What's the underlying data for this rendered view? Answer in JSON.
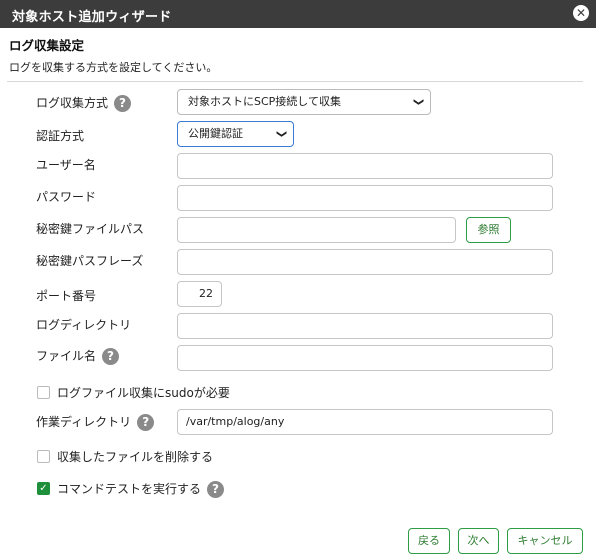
{
  "window": {
    "title": "対象ホスト追加ウィザード",
    "close_icon": "✕"
  },
  "section": {
    "title": "ログ収集設定",
    "description": "ログを収集する方式を設定してください。"
  },
  "form": {
    "collect_method": {
      "label": "ログ収集方式",
      "value": "対象ホストにSCP接続して収集"
    },
    "auth_method": {
      "label": "認証方式",
      "value": "公開鍵認証"
    },
    "username": {
      "label": "ユーザー名",
      "value": ""
    },
    "password": {
      "label": "パスワード",
      "value": ""
    },
    "key_file": {
      "label": "秘密鍵ファイルパス",
      "value": "",
      "browse_label": "参照"
    },
    "passphrase": {
      "label": "秘密鍵パスフレーズ",
      "value": ""
    },
    "port": {
      "label": "ポート番号",
      "value": "22"
    },
    "log_dir": {
      "label": "ログディレクトリ",
      "value": ""
    },
    "file_name": {
      "label": "ファイル名",
      "value": ""
    },
    "sudo": {
      "label": "ログファイル収集にsudoが必要",
      "checked": false
    },
    "work_dir": {
      "label": "作業ディレクトリ",
      "value": "/var/tmp/alog/any"
    },
    "delete_after": {
      "label": "収集したファイルを削除する",
      "checked": false
    },
    "command_test": {
      "label": "コマンドテストを実行する",
      "checked": true
    }
  },
  "help_icon": "?",
  "checkmark": "✓",
  "chevron": "❯",
  "footer": {
    "back_label": "戻る",
    "next_label": "次へ",
    "cancel_label": "キャンセル"
  }
}
